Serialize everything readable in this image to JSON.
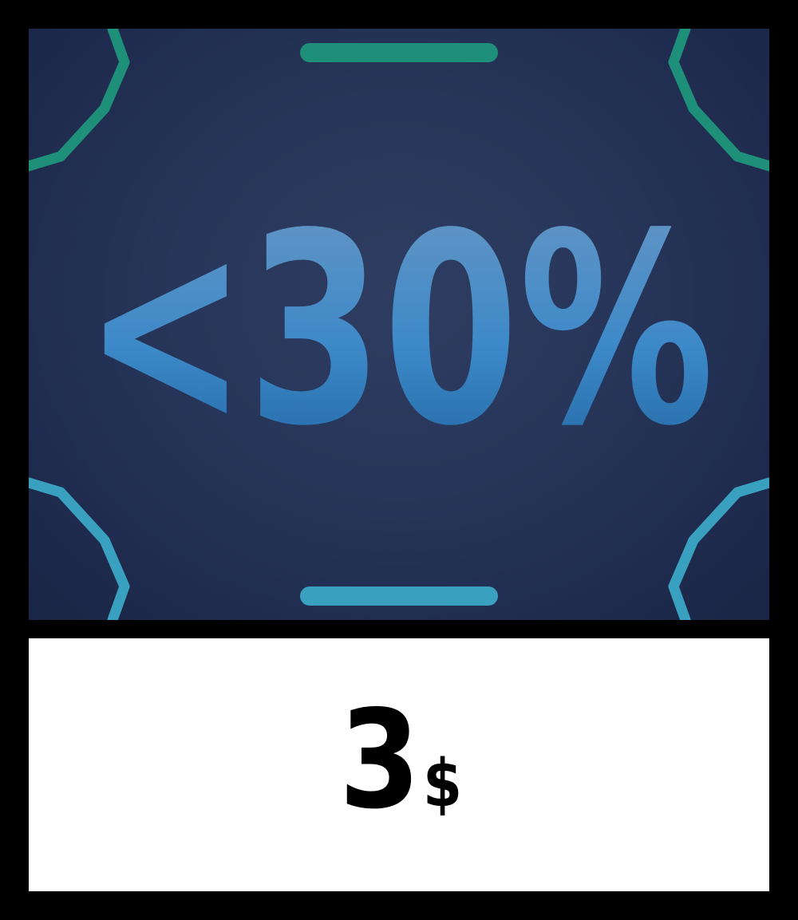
{
  "badge": {
    "text": "<30%",
    "color_top": "#6a97c4",
    "color_bottom": "#1f63a0"
  },
  "frame": {
    "top_color": "#1e8f78",
    "bottom_color": "#3aa0c0",
    "background": "#27365a"
  },
  "price": {
    "amount": "3",
    "currency": "$"
  }
}
